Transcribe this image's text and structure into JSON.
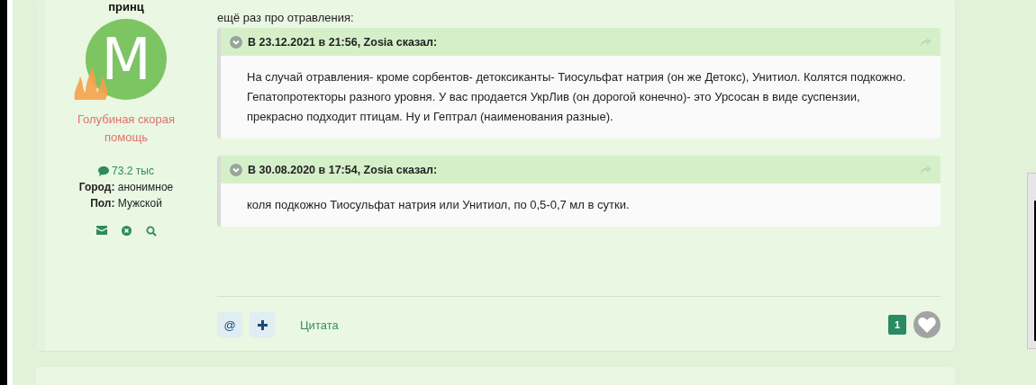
{
  "user": {
    "name": "принц",
    "avatar_letter": "M",
    "title": "Голубиная скорая помощь",
    "messages": "73.2 тыс",
    "fields": [
      {
        "label": "Город:",
        "value": "анонимное"
      },
      {
        "label": "Пол:",
        "value": "Мужской"
      }
    ]
  },
  "post": {
    "intro": "ещё раз про отравления:",
    "quotes": [
      {
        "header": "В 23.12.2021 в 21:56, Zosia сказал:",
        "paragraphs": [
          "На случай отравления- кроме сорбентов- детоксиканты- Тиосульфат натрия (он же Детокс), Унитиол. Колятся подкожно.",
          "Гепатопротекторы разного уровня. У вас продается УкрЛив (он дорогой конечно)- это Урсосан в виде суспензии, прекрасно подходит птицам. Ну и Гептрал (наименования разные)."
        ]
      },
      {
        "header": "В 30.08.2020 в 17:54, Zosia сказал:",
        "paragraphs": [
          "коля подкожно Тиосульфат натрия или Унитиол, по 0,5-0,7 мл в сутки."
        ]
      }
    ]
  },
  "footer": {
    "mention": "@",
    "quote_link": "Цитата",
    "like_count": "1"
  }
}
